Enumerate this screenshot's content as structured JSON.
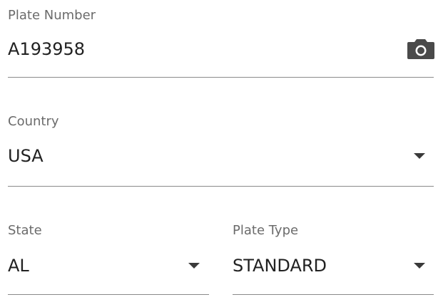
{
  "plate_number": {
    "label": "Plate Number",
    "value": "A193958",
    "action_icon": "camera-icon"
  },
  "country": {
    "label": "Country",
    "value": "USA"
  },
  "state": {
    "label": "State",
    "value": "AL"
  },
  "plate_type": {
    "label": "Plate Type",
    "value": "STANDARD"
  },
  "colors": {
    "label_text": "#6b6b6b",
    "value_text": "#212121",
    "underline": "#8a8a8a",
    "icon": "#4a4a4a"
  }
}
